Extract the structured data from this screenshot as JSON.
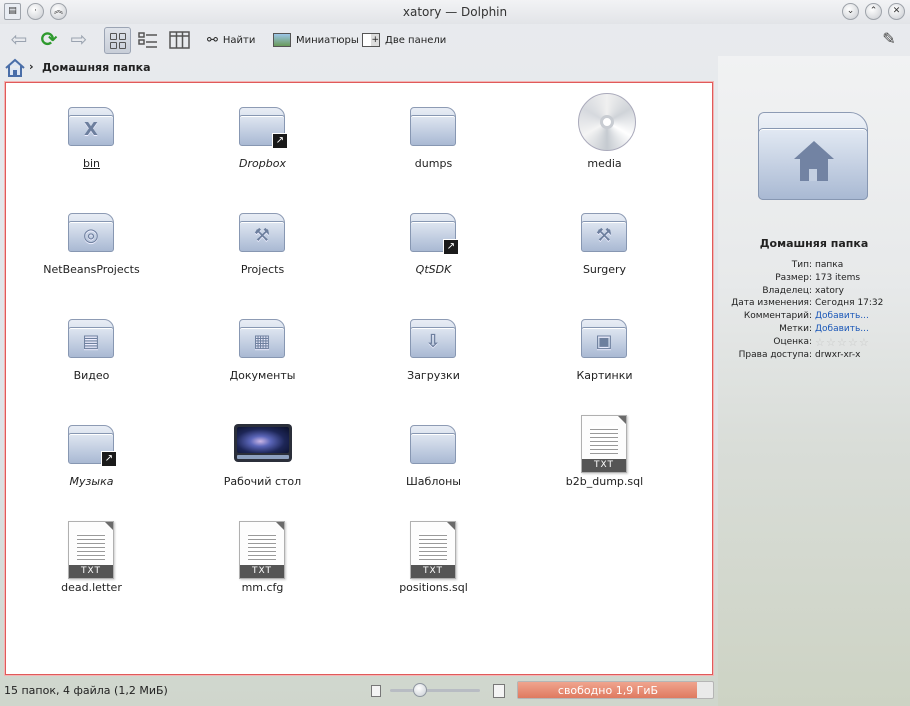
{
  "window": {
    "title": "xatory — Dolphin",
    "left_buttons": [
      "app-menu",
      "sticky",
      "keep-above"
    ],
    "right_buttons": [
      "minimize",
      "maximize",
      "close"
    ]
  },
  "toolbar": {
    "find_label": "Найти",
    "preview_label": "Миниатюры",
    "split_label": "Две панели"
  },
  "breadcrumb": {
    "path": "Домашняя папка"
  },
  "items": [
    {
      "label": "bin",
      "kind": "folder",
      "emblem": "X",
      "italic": false,
      "link": false
    },
    {
      "label": "Dropbox",
      "kind": "folder",
      "emblem": "",
      "italic": true,
      "link": true
    },
    {
      "label": "dumps",
      "kind": "folder",
      "emblem": "",
      "italic": false,
      "link": false
    },
    {
      "label": "media",
      "kind": "cd",
      "emblem": "",
      "italic": false,
      "link": false
    },
    {
      "label": "NetBeansProjects",
      "kind": "folder",
      "emblem": "◎",
      "italic": false,
      "link": false
    },
    {
      "label": "Projects",
      "kind": "folder",
      "emblem": "⚒",
      "italic": false,
      "link": false
    },
    {
      "label": "QtSDK",
      "kind": "folder",
      "emblem": "",
      "italic": true,
      "link": true
    },
    {
      "label": "Surgery",
      "kind": "folder",
      "emblem": "⚒",
      "italic": false,
      "link": false
    },
    {
      "label": "Видео",
      "kind": "folder",
      "emblem": "▤",
      "italic": false,
      "link": false
    },
    {
      "label": "Документы",
      "kind": "folder",
      "emblem": "▦",
      "italic": false,
      "link": false
    },
    {
      "label": "Загрузки",
      "kind": "folder",
      "emblem": "⇩",
      "italic": false,
      "link": false
    },
    {
      "label": "Картинки",
      "kind": "folder",
      "emblem": "▣",
      "italic": false,
      "link": false
    },
    {
      "label": "Музыка",
      "kind": "folder",
      "emblem": "",
      "italic": true,
      "link": true
    },
    {
      "label": "Рабочий стол",
      "kind": "desktop",
      "emblem": "",
      "italic": false,
      "link": false
    },
    {
      "label": "Шаблоны",
      "kind": "folder",
      "emblem": "",
      "italic": false,
      "link": false
    },
    {
      "label": "b2b_dump.sql",
      "kind": "txt",
      "emblem": "",
      "italic": false,
      "link": false
    },
    {
      "label": "dead.letter",
      "kind": "txt",
      "emblem": "",
      "italic": false,
      "link": false
    },
    {
      "label": "mm.cfg",
      "kind": "txt",
      "emblem": "",
      "italic": false,
      "link": false
    },
    {
      "label": "positions.sql",
      "kind": "txt",
      "emblem": "",
      "italic": false,
      "link": false
    }
  ],
  "txt_tag": "TXT",
  "sidebar": {
    "name": "Домашняя папка",
    "props": [
      {
        "key": "Тип:",
        "value": "папка",
        "link": false
      },
      {
        "key": "Размер:",
        "value": "173 items",
        "link": false
      },
      {
        "key": "Владелец:",
        "value": "xatory",
        "link": false
      },
      {
        "key": "Дата изменения:",
        "value": "Сегодня 17:32",
        "link": false
      },
      {
        "key": "Комментарий:",
        "value": "Добавить...",
        "link": true
      },
      {
        "key": "Метки:",
        "value": "Добавить...",
        "link": true
      },
      {
        "key": "Оценка:",
        "value": "",
        "link": false,
        "stars": 0
      },
      {
        "key": "Права доступа:",
        "value": "drwxr-xr-x",
        "link": false
      }
    ]
  },
  "status": {
    "text": "15 папок, 4 файла (1,2 МиБ)",
    "free_space": "свободно 1,9 ГиБ",
    "used_fraction": 0.92,
    "zoom_fraction": 0.3
  },
  "colors": {
    "selection_border": "#e05a5a",
    "link": "#1b58b8",
    "space_bar": "#df7a60"
  }
}
